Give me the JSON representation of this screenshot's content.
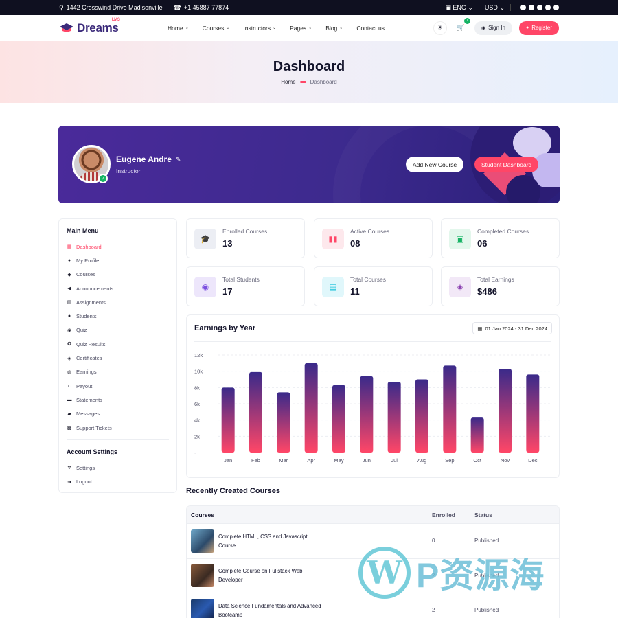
{
  "topbar": {
    "address": "1442 Crosswind Drive Madisonville",
    "phone": "+1 45887 77874",
    "language": "ENG",
    "currency": "USD"
  },
  "header": {
    "logo_text": "Dreams",
    "logo_sub": "LMS",
    "nav": [
      {
        "label": "Home",
        "dropdown": true
      },
      {
        "label": "Courses",
        "dropdown": true
      },
      {
        "label": "Instructors",
        "dropdown": true
      },
      {
        "label": "Pages",
        "dropdown": true
      },
      {
        "label": "Blog",
        "dropdown": true
      },
      {
        "label": "Contact us",
        "dropdown": false
      }
    ],
    "cart_count": "1",
    "signin_label": "Sign In",
    "register_label": "Register"
  },
  "hero": {
    "title": "Dashboard",
    "breadcrumb_home": "Home",
    "breadcrumb_current": "Dashboard"
  },
  "profile": {
    "name": "Eugene Andre",
    "role": "Instructor",
    "add_course_label": "Add New Course",
    "student_dashboard_label": "Student Dashboard"
  },
  "sidebar": {
    "main_heading": "Main Menu",
    "main_items": [
      {
        "label": "Dashboard",
        "icon": "grid-icon",
        "glyph": "▦",
        "active": true
      },
      {
        "label": "My Profile",
        "icon": "user-icon",
        "glyph": "●"
      },
      {
        "label": "Courses",
        "icon": "rocket-icon",
        "glyph": "◆"
      },
      {
        "label": "Announcements",
        "icon": "megaphone-icon",
        "glyph": "◀"
      },
      {
        "label": "Assignments",
        "icon": "clipboard-icon",
        "glyph": "▤"
      },
      {
        "label": "Students",
        "icon": "users-icon",
        "glyph": "●"
      },
      {
        "label": "Quiz",
        "icon": "medal-icon",
        "glyph": "◉"
      },
      {
        "label": "Quiz Results",
        "icon": "award-icon",
        "glyph": "✪"
      },
      {
        "label": "Certificates",
        "icon": "certificate-icon",
        "glyph": "◈"
      },
      {
        "label": "Earnings",
        "icon": "coins-icon",
        "glyph": "◍"
      },
      {
        "label": "Payout",
        "icon": "payout-icon",
        "glyph": "◐"
      },
      {
        "label": "Statements",
        "icon": "statement-icon",
        "glyph": "▬"
      },
      {
        "label": "Messages",
        "icon": "messages-icon",
        "glyph": "▰"
      },
      {
        "label": "Support Tickets",
        "icon": "ticket-icon",
        "glyph": "▩"
      }
    ],
    "account_heading": "Account Settings",
    "account_items": [
      {
        "label": "Settings",
        "icon": "gear-icon",
        "glyph": "✲"
      },
      {
        "label": "Logout",
        "icon": "logout-icon",
        "glyph": "➜"
      }
    ]
  },
  "stats": [
    {
      "label": "Enrolled Courses",
      "value": "13",
      "icon": "graduation-cap-icon",
      "glyph": "🎓",
      "bg": "#eceef4",
      "fg": "#342a80"
    },
    {
      "label": "Active Courses",
      "value": "08",
      "icon": "book-open-icon",
      "glyph": "▮▮",
      "bg": "#fde8ec",
      "fg": "#ff4667"
    },
    {
      "label": "Completed Courses",
      "value": "06",
      "icon": "certificate-icon",
      "glyph": "▣",
      "bg": "#e3f7ec",
      "fg": "#16b364"
    },
    {
      "label": "Total Students",
      "value": "17",
      "icon": "student-icon",
      "glyph": "◉",
      "bg": "#ede6fb",
      "fg": "#7b4fe0"
    },
    {
      "label": "Total Courses",
      "value": "11",
      "icon": "courses-icon",
      "glyph": "▤",
      "bg": "#e0f7fb",
      "fg": "#18c1d9"
    },
    {
      "label": "Total Earnings",
      "value": "$486",
      "icon": "earnings-icon",
      "glyph": "◈",
      "bg": "#f2e8f7",
      "fg": "#8a3fb0"
    }
  ],
  "chart": {
    "title": "Earnings by Year",
    "date_range": "01 Jan 2024 - 31 Dec 2024"
  },
  "chart_data": {
    "type": "bar",
    "categories": [
      "Jan",
      "Feb",
      "Mar",
      "Apr",
      "May",
      "Jun",
      "Jul",
      "Aug",
      "Sep",
      "Oct",
      "Nov",
      "Dec"
    ],
    "values": [
      8000,
      9900,
      7400,
      11000,
      8300,
      9400,
      8700,
      9000,
      10700,
      4300,
      10300,
      9600
    ],
    "y_ticks": [
      "-",
      "2k",
      "4k",
      "6k",
      "8k",
      "10k",
      "12k"
    ],
    "ylim": [
      0,
      12000
    ],
    "grid": true,
    "colors": {
      "top": "#3a2a8a",
      "bottom": "#ff4667"
    }
  },
  "recent": {
    "heading": "Recently Created Courses",
    "columns": [
      "Courses",
      "Enrolled",
      "Status"
    ],
    "rows": [
      {
        "name": "Complete HTML, CSS and Javascript Course",
        "enrolled": "0",
        "status": "Published"
      },
      {
        "name": "Complete Course on Fullstack Web Developer",
        "enrolled": "2",
        "status": "Published"
      },
      {
        "name": "Data Science Fundamentals and Advanced Bootcamp",
        "enrolled": "2",
        "status": "Published"
      }
    ]
  },
  "watermark": {
    "text": "P资源海",
    "logo_letter": "W"
  }
}
